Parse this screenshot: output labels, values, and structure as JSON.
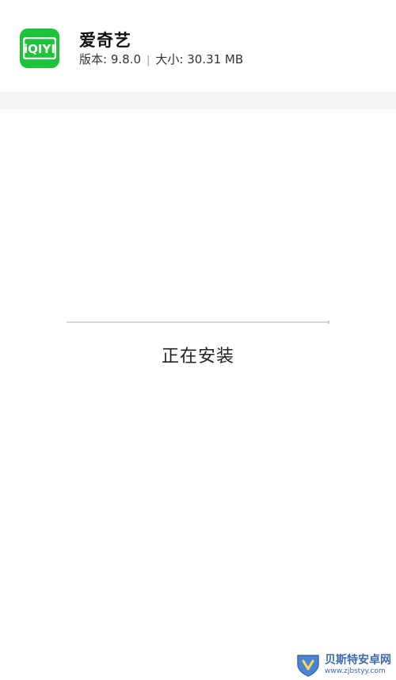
{
  "app": {
    "name": "爱奇艺",
    "icon_name": "iqiyi-logo-icon",
    "icon_text": "iQIYI",
    "version_label": "版本: 9.8.0",
    "separator": "|",
    "size_label": "大小: 30.31 MB",
    "brand_color": "#1dc43a"
  },
  "install": {
    "status": "正在安装",
    "progress": 1.0
  },
  "watermark": {
    "title": "贝斯特安卓网",
    "url": "www.zjbstyy.com"
  }
}
